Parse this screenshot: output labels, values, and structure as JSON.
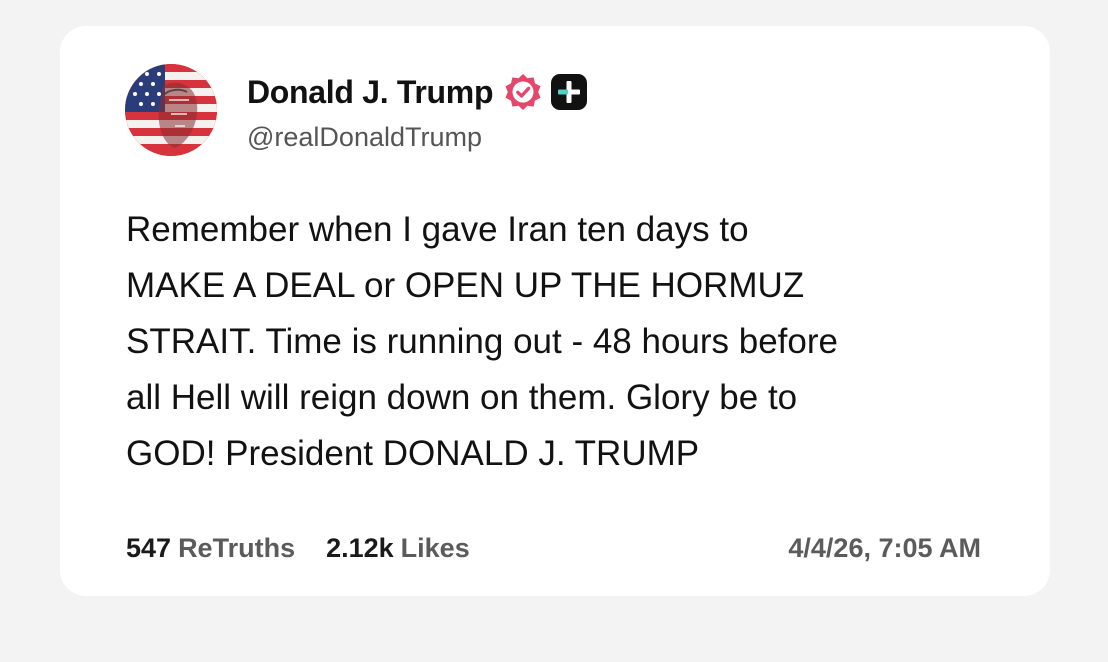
{
  "post": {
    "author_name": "Donald J. Trump",
    "handle": "@realDonaldTrump",
    "verified_icon": "verified-badge-icon",
    "plus_icon": "plus-badge-icon",
    "body": "Remember when I gave Iran ten days to\nMAKE A DEAL or OPEN UP THE HORMUZ\nSTRAIT. Time is running out - 48 hours before\nall Hell will reign down on them. Glory be to\nGOD! President DONALD J. TRUMP",
    "retruths_count": "547",
    "retruths_label": "ReTruths",
    "likes_count": "2.12k",
    "likes_label": "Likes",
    "timestamp": "4/4/26, 7:05 AM"
  },
  "colors": {
    "verified": "#e5476b",
    "plus_badge": "#111111",
    "text_primary": "#111111",
    "text_secondary": "#5b5b5b"
  }
}
